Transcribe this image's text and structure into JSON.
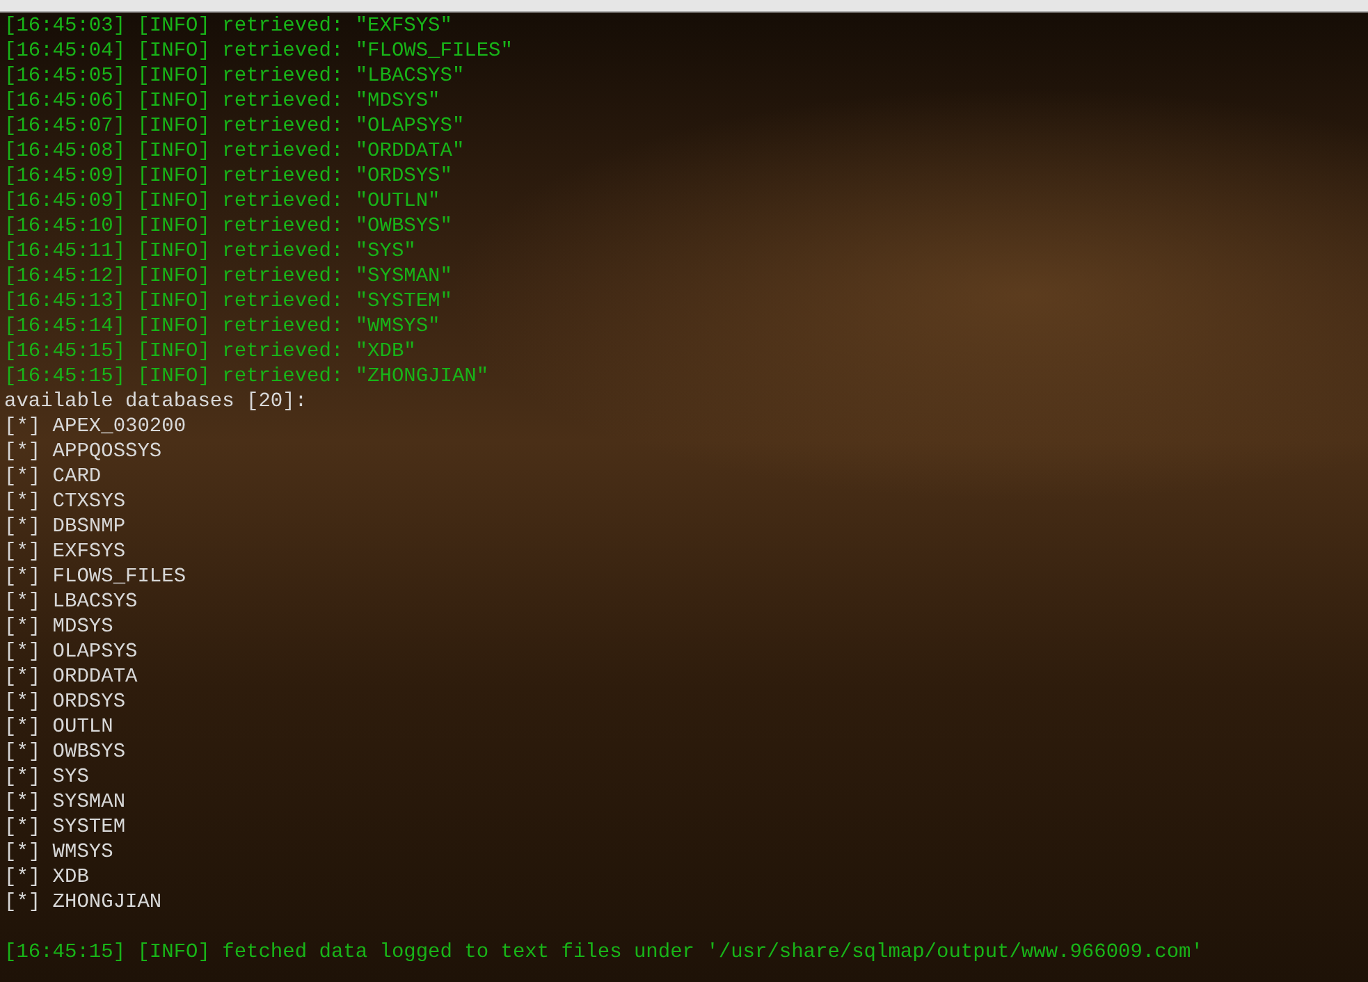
{
  "log": [
    {
      "kind": "info",
      "text": "[16:45:03] [INFO] retrieved: \"EXFSYS\""
    },
    {
      "kind": "info",
      "text": "[16:45:04] [INFO] retrieved: \"FLOWS_FILES\""
    },
    {
      "kind": "info",
      "text": "[16:45:05] [INFO] retrieved: \"LBACSYS\""
    },
    {
      "kind": "info",
      "text": "[16:45:06] [INFO] retrieved: \"MDSYS\""
    },
    {
      "kind": "info",
      "text": "[16:45:07] [INFO] retrieved: \"OLAPSYS\""
    },
    {
      "kind": "info",
      "text": "[16:45:08] [INFO] retrieved: \"ORDDATA\""
    },
    {
      "kind": "info",
      "text": "[16:45:09] [INFO] retrieved: \"ORDSYS\""
    },
    {
      "kind": "info",
      "text": "[16:45:09] [INFO] retrieved: \"OUTLN\""
    },
    {
      "kind": "info",
      "text": "[16:45:10] [INFO] retrieved: \"OWBSYS\""
    },
    {
      "kind": "info",
      "text": "[16:45:11] [INFO] retrieved: \"SYS\""
    },
    {
      "kind": "info",
      "text": "[16:45:12] [INFO] retrieved: \"SYSMAN\""
    },
    {
      "kind": "info",
      "text": "[16:45:13] [INFO] retrieved: \"SYSTEM\""
    },
    {
      "kind": "info",
      "text": "[16:45:14] [INFO] retrieved: \"WMSYS\""
    },
    {
      "kind": "info",
      "text": "[16:45:15] [INFO] retrieved: \"XDB\""
    },
    {
      "kind": "info",
      "text": "[16:45:15] [INFO] retrieved: \"ZHONGJIAN\""
    },
    {
      "kind": "plain",
      "text": "available databases [20]:"
    },
    {
      "kind": "plain",
      "text": "[*] APEX_030200"
    },
    {
      "kind": "plain",
      "text": "[*] APPQOSSYS"
    },
    {
      "kind": "plain",
      "text": "[*] CARD"
    },
    {
      "kind": "plain",
      "text": "[*] CTXSYS"
    },
    {
      "kind": "plain",
      "text": "[*] DBSNMP"
    },
    {
      "kind": "plain",
      "text": "[*] EXFSYS"
    },
    {
      "kind": "plain",
      "text": "[*] FLOWS_FILES"
    },
    {
      "kind": "plain",
      "text": "[*] LBACSYS"
    },
    {
      "kind": "plain",
      "text": "[*] MDSYS"
    },
    {
      "kind": "plain",
      "text": "[*] OLAPSYS"
    },
    {
      "kind": "plain",
      "text": "[*] ORDDATA"
    },
    {
      "kind": "plain",
      "text": "[*] ORDSYS"
    },
    {
      "kind": "plain",
      "text": "[*] OUTLN"
    },
    {
      "kind": "plain",
      "text": "[*] OWBSYS"
    },
    {
      "kind": "plain",
      "text": "[*] SYS"
    },
    {
      "kind": "plain",
      "text": "[*] SYSMAN"
    },
    {
      "kind": "plain",
      "text": "[*] SYSTEM"
    },
    {
      "kind": "plain",
      "text": "[*] WMSYS"
    },
    {
      "kind": "plain",
      "text": "[*] XDB"
    },
    {
      "kind": "plain",
      "text": "[*] ZHONGJIAN"
    }
  ],
  "summary": {
    "kind": "info",
    "text": "[16:45:15] [INFO] fetched data logged to text files under '/usr/share/sqlmap/output/www.966009.com'"
  }
}
